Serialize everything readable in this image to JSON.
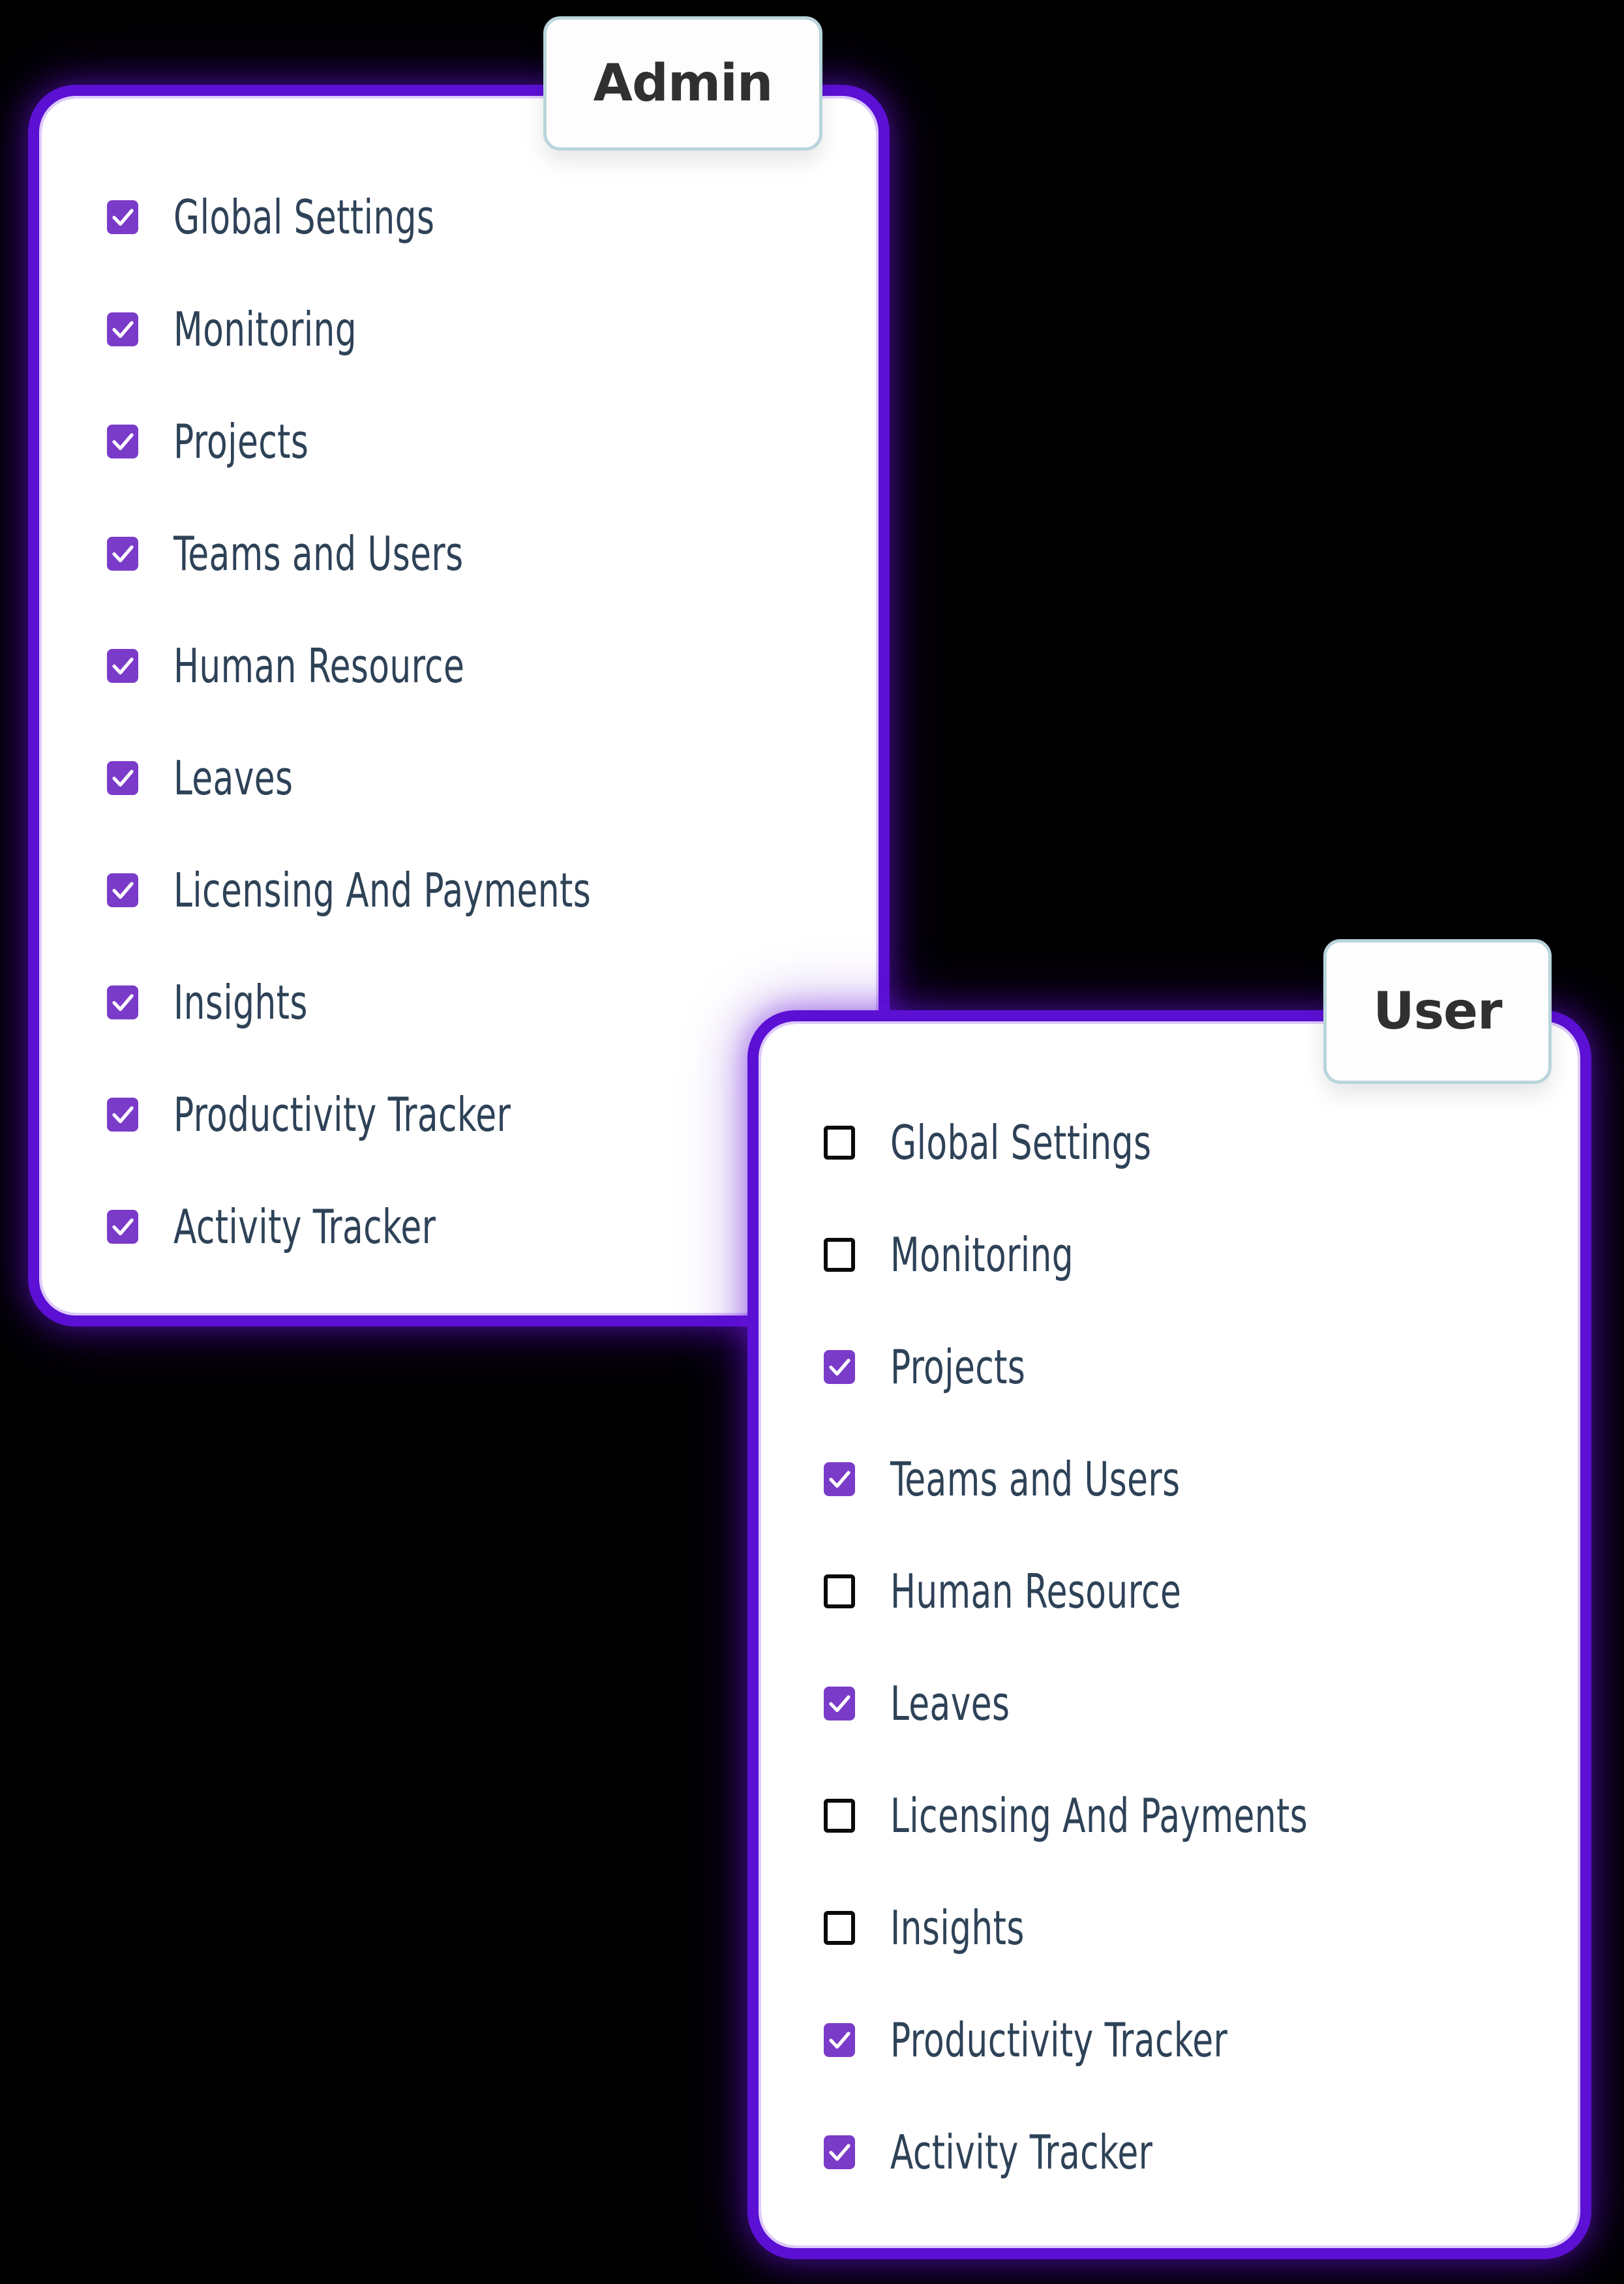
{
  "background_color": "#000000",
  "theme": {
    "card_border_color": "#5b10d4",
    "card_inner_hairline": "#e6d5fd",
    "card_background": "#ffffff",
    "checkbox_checked_color": "#7b3bc9",
    "checkbox_checkmark_color": "#ffffff",
    "checkbox_unchecked_border_color": "#0a0a0a",
    "label_text_color": "#2e4257",
    "tab_background": "#fdfdfd",
    "tab_border_color": "#b9d5db",
    "tab_text_color": "#303030"
  },
  "cards": [
    {
      "id": "admin",
      "tab_label": "Admin",
      "permissions": [
        {
          "label": "Global Settings",
          "checked": true
        },
        {
          "label": "Monitoring",
          "checked": true
        },
        {
          "label": "Projects",
          "checked": true
        },
        {
          "label": "Teams and Users",
          "checked": true
        },
        {
          "label": "Human Resource",
          "checked": true
        },
        {
          "label": "Leaves",
          "checked": true
        },
        {
          "label": "Licensing And Payments",
          "checked": true
        },
        {
          "label": "Insights",
          "checked": true
        },
        {
          "label": "Productivity Tracker",
          "checked": true
        },
        {
          "label": "Activity Tracker",
          "checked": true
        }
      ]
    },
    {
      "id": "user",
      "tab_label": "User",
      "permissions": [
        {
          "label": "Global Settings",
          "checked": false
        },
        {
          "label": "Monitoring",
          "checked": false
        },
        {
          "label": "Projects",
          "checked": true
        },
        {
          "label": "Teams and Users",
          "checked": true
        },
        {
          "label": "Human Resource",
          "checked": false
        },
        {
          "label": "Leaves",
          "checked": true
        },
        {
          "label": "Licensing And Payments",
          "checked": false
        },
        {
          "label": "Insights",
          "checked": false
        },
        {
          "label": "Productivity Tracker",
          "checked": true
        },
        {
          "label": "Activity Tracker",
          "checked": true
        }
      ]
    }
  ],
  "icons": {
    "checkmark": "check-icon"
  }
}
